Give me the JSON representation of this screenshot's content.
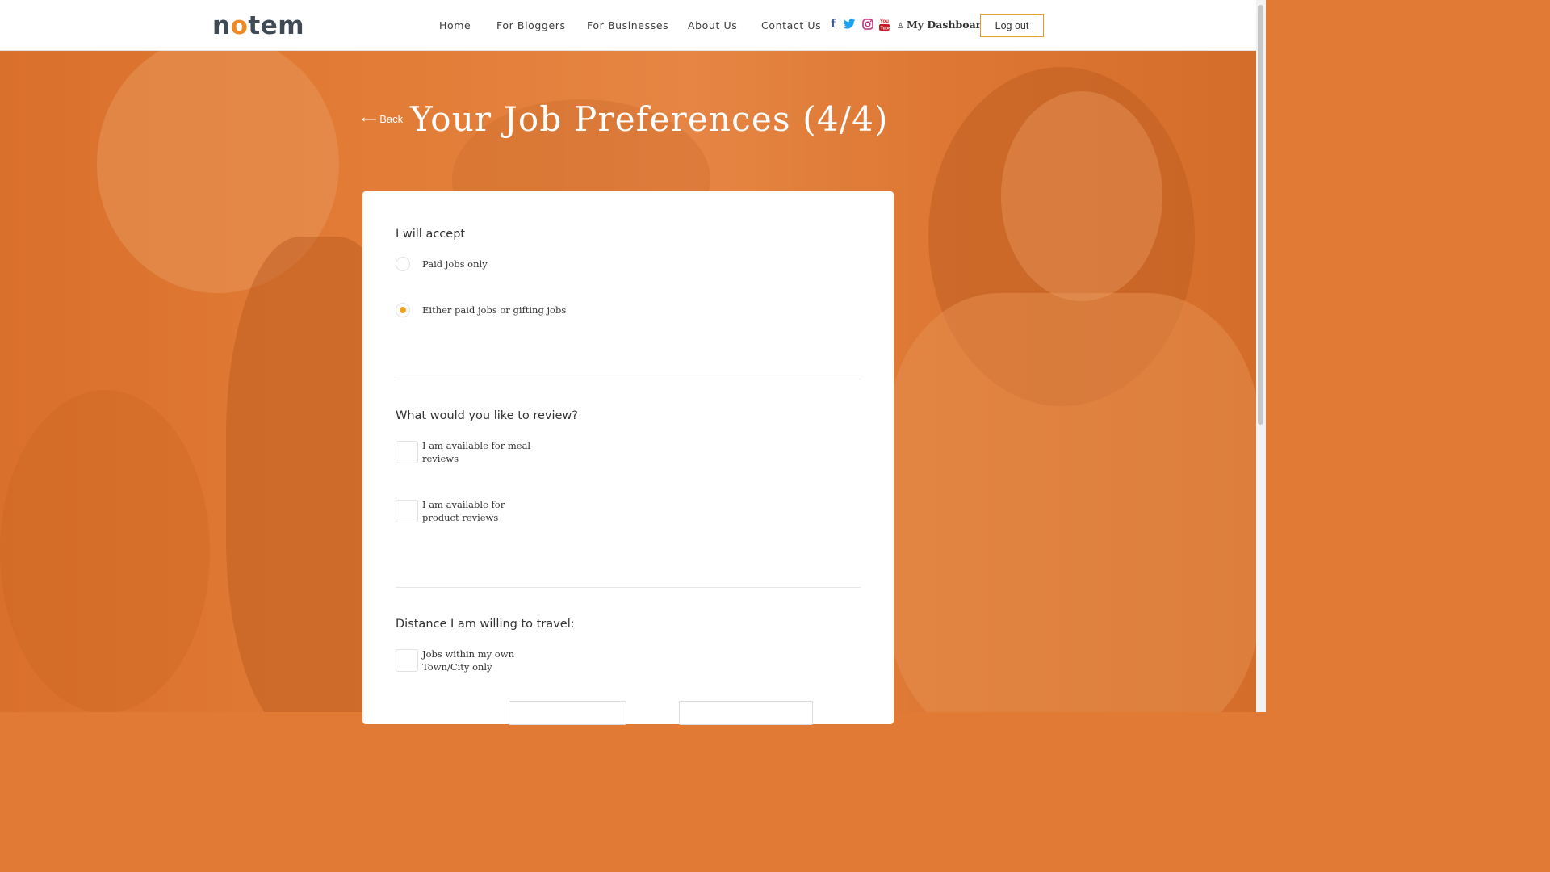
{
  "brand": {
    "logo_n": "n",
    "logo_o": "o",
    "logo_rest": "tem"
  },
  "nav": {
    "home": "Home",
    "bloggers": "For Bloggers",
    "businesses": "For Businesses",
    "about": "About Us",
    "contact": "Contact Us",
    "dashboard": "My Dashboard",
    "logout": "Log out"
  },
  "social": [
    {
      "icon": "facebook-icon",
      "glyph": "f",
      "color": "#3b5998"
    },
    {
      "icon": "twitter-icon",
      "glyph": "🐦",
      "color": "#1da1f2"
    },
    {
      "icon": "instagram-icon",
      "glyph": "◎",
      "color": "#c13584"
    },
    {
      "icon": "youtube-icon",
      "glyph": "▶",
      "color": "#cc181e"
    }
  ],
  "page": {
    "back": "Back",
    "title": "Your Job Preferences (4/4)"
  },
  "form": {
    "accept": {
      "question": "I will accept",
      "options": [
        "Paid jobs only",
        "Either paid jobs or gifting jobs"
      ],
      "selected": "Either paid jobs or gifting jobs"
    },
    "review": {
      "question": "What would you like to review?",
      "options": [
        "I am available for meal reviews",
        "I am available for product reviews"
      ]
    },
    "distance": {
      "question": "Distance I am willing to travel:",
      "options": [
        "Jobs within my own Town/City only"
      ]
    }
  },
  "colors": {
    "accent": "#f0a020",
    "overlay": "#e07a35",
    "button_border": "#e59a2e"
  }
}
